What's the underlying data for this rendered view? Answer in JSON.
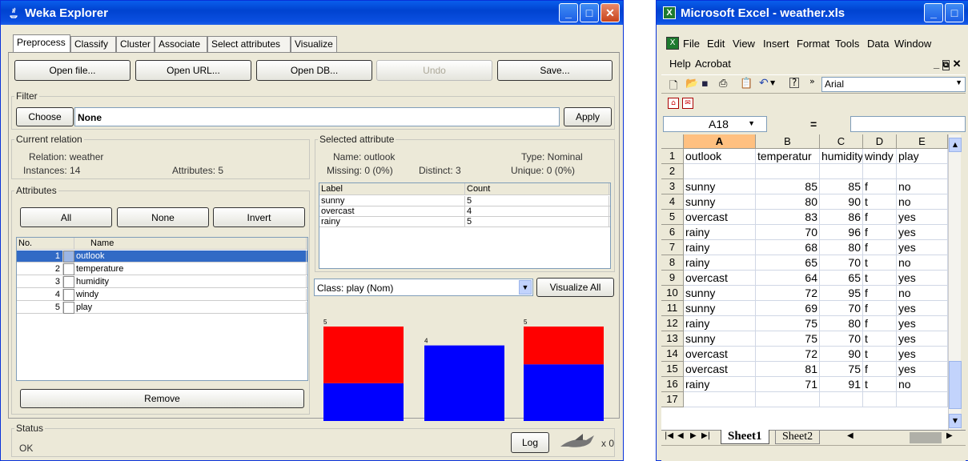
{
  "weka": {
    "title": "Weka Explorer",
    "tabs": [
      "Preprocess",
      "Classify",
      "Cluster",
      "Associate",
      "Select attributes",
      "Visualize"
    ],
    "buttons": {
      "open_file": "Open file...",
      "open_url": "Open URL...",
      "open_db": "Open DB...",
      "undo": "Undo",
      "save": "Save..."
    },
    "filter": {
      "label": "Filter",
      "choose": "Choose",
      "value": "None",
      "apply": "Apply"
    },
    "relation": {
      "label": "Current relation",
      "relation": "Relation: weather",
      "instances": "Instances: 14",
      "attributes": "Attributes: 5"
    },
    "attributes": {
      "label": "Attributes",
      "all": "All",
      "none": "None",
      "invert": "Invert",
      "col_no": "No.",
      "col_name": "Name",
      "rows": [
        {
          "no": "1",
          "name": "outlook"
        },
        {
          "no": "2",
          "name": "temperature"
        },
        {
          "no": "3",
          "name": "humidity"
        },
        {
          "no": "4",
          "name": "windy"
        },
        {
          "no": "5",
          "name": "play"
        }
      ],
      "remove": "Remove"
    },
    "selected": {
      "label": "Selected attribute",
      "name": "Name: outlook",
      "type": "Type: Nominal",
      "missing": "Missing: 0 (0%)",
      "distinct": "Distinct: 3",
      "unique": "Unique: 0 (0%)",
      "col_label": "Label",
      "col_count": "Count",
      "rows": [
        {
          "label": "sunny",
          "count": "5"
        },
        {
          "label": "overcast",
          "count": "4"
        },
        {
          "label": "rainy",
          "count": "5"
        }
      ]
    },
    "class_select": "Class: play (Nom)",
    "visualize_all": "Visualize All",
    "histogram": [
      {
        "total": 5,
        "red": 3,
        "blue": 2,
        "label": "5"
      },
      {
        "total": 4,
        "red": 0,
        "blue": 4,
        "label": "4"
      },
      {
        "total": 5,
        "red": 2,
        "blue": 3,
        "label": "5"
      }
    ],
    "status": {
      "label": "Status",
      "text": "OK",
      "log": "Log",
      "count": "x 0"
    },
    "colors": {
      "red": "#ff0000",
      "blue": "#0000ff",
      "selected_row": "#316ac5"
    }
  },
  "excel": {
    "title": "Microsoft Excel - weather.xls",
    "menu1": [
      "File",
      "Edit",
      "View",
      "Insert",
      "Format",
      "Tools",
      "Data",
      "Window"
    ],
    "menu2": [
      "Help",
      "Acrobat"
    ],
    "font": "Arial",
    "cell_ref": "A18",
    "formula_eq": "=",
    "columns": [
      "A",
      "B",
      "C",
      "D",
      "E"
    ],
    "rows": [
      {
        "n": "1",
        "a": "outlook",
        "b": "temperatur",
        "c": "humidity",
        "d": "windy",
        "e": "play"
      },
      {
        "n": "2",
        "a": "",
        "b": "",
        "c": "",
        "d": "",
        "e": ""
      },
      {
        "n": "3",
        "a": "sunny",
        "b": "85",
        "c": "85",
        "d": "f",
        "e": "no"
      },
      {
        "n": "4",
        "a": "sunny",
        "b": "80",
        "c": "90",
        "d": "t",
        "e": "no"
      },
      {
        "n": "5",
        "a": "overcast",
        "b": "83",
        "c": "86",
        "d": "f",
        "e": "yes"
      },
      {
        "n": "6",
        "a": "rainy",
        "b": "70",
        "c": "96",
        "d": "f",
        "e": "yes"
      },
      {
        "n": "7",
        "a": "rainy",
        "b": "68",
        "c": "80",
        "d": "f",
        "e": "yes"
      },
      {
        "n": "8",
        "a": "rainy",
        "b": "65",
        "c": "70",
        "d": "t",
        "e": "no"
      },
      {
        "n": "9",
        "a": "overcast",
        "b": "64",
        "c": "65",
        "d": "t",
        "e": "yes"
      },
      {
        "n": "10",
        "a": "sunny",
        "b": "72",
        "c": "95",
        "d": "f",
        "e": "no"
      },
      {
        "n": "11",
        "a": "sunny",
        "b": "69",
        "c": "70",
        "d": "f",
        "e": "yes"
      },
      {
        "n": "12",
        "a": "rainy",
        "b": "75",
        "c": "80",
        "d": "f",
        "e": "yes"
      },
      {
        "n": "13",
        "a": "sunny",
        "b": "75",
        "c": "70",
        "d": "t",
        "e": "yes"
      },
      {
        "n": "14",
        "a": "overcast",
        "b": "72",
        "c": "90",
        "d": "t",
        "e": "yes"
      },
      {
        "n": "15",
        "a": "overcast",
        "b": "81",
        "c": "75",
        "d": "f",
        "e": "yes"
      },
      {
        "n": "16",
        "a": "rainy",
        "b": "71",
        "c": "91",
        "d": "t",
        "e": "no"
      },
      {
        "n": "17",
        "a": "",
        "b": "",
        "c": "",
        "d": "",
        "e": ""
      }
    ],
    "sheets": [
      "Sheet1",
      "Sheet2"
    ]
  }
}
